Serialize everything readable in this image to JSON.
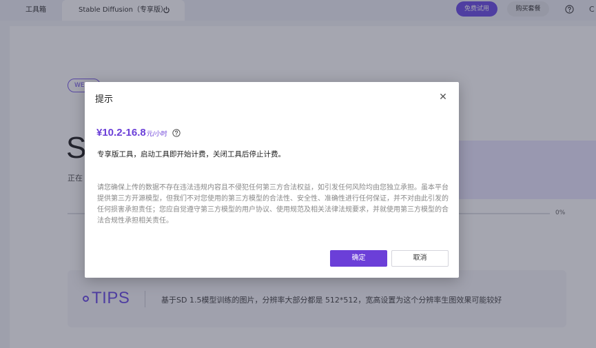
{
  "tabs": {
    "toolbox": "工具箱",
    "stable_diffusion": "Stable Diffusion（专享版）"
  },
  "header": {
    "free_trial": "免费试用",
    "buy_plan": "购买套餐",
    "more": "C"
  },
  "page": {
    "webui_badge": "WE",
    "title_initial": "S",
    "loading_text": "正在",
    "progress_text": "0%",
    "progress": 0
  },
  "tips": {
    "logo_text": "TIPS",
    "text": "基于SD 1.5模型训练的图片，分辨率大部分都是 512*512，宽高设置为这个分辨率生图效果可能较好"
  },
  "dialog": {
    "title": "提示",
    "price": "¥10.2-16.8",
    "price_unit": "元/小时",
    "billing_note": "专享版工具，启动工具即开始计费，关闭工具后停止计费。",
    "disclaimer": "请您确保上传的数据不存在违法违规内容且不侵犯任何第三方合法权益，如引发任何风险均由您独立承担。虽本平台提供第三方开源模型，但我们不对您使用的第三方模型的合法性、安全性、准确性进行任何保证，并不对由此引发的任何损害承担责任；您应自觉遵守第三方模型的用户协议、使用规范及相关法律法规要求，并就使用第三方模型的合法合规性承担相关责任。",
    "confirm": "确定",
    "cancel": "取消"
  },
  "colors": {
    "accent": "#6b3fd8",
    "overlay": "rgba(40,44,66,0.42)"
  },
  "icons": {
    "power": "power-icon",
    "help": "question-circle-icon",
    "close": "close-icon"
  }
}
